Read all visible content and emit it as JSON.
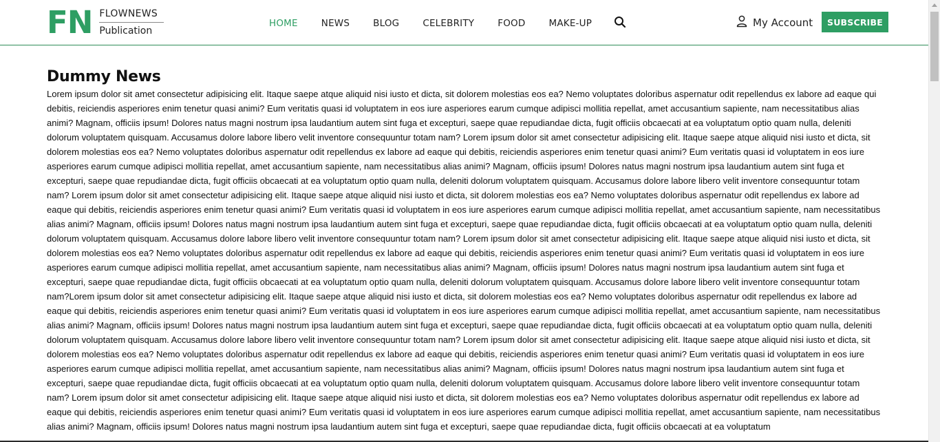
{
  "brand": {
    "mark": "FN",
    "name": "FLOWNEWS",
    "tagline": "Publication"
  },
  "nav": {
    "items": [
      {
        "label": "HOME",
        "active": true
      },
      {
        "label": "NEWS",
        "active": false
      },
      {
        "label": "BLOG",
        "active": false
      },
      {
        "label": "CELEBRITY",
        "active": false
      },
      {
        "label": "FOOD",
        "active": false
      },
      {
        "label": "MAKE-UP",
        "active": false
      }
    ],
    "search_icon": "search-icon"
  },
  "account": {
    "icon": "user-icon",
    "label": "My Account"
  },
  "subscribe": {
    "label": "SUBSCRIBE"
  },
  "article": {
    "title": "Dummy News",
    "body": "Lorem ipsum dolor sit amet consectetur adipisicing elit. Itaque saepe atque aliquid nisi iusto et dicta, sit dolorem molestias eos ea? Nemo voluptates doloribus aspernatur odit repellendus ex labore ad eaque qui debitis, reiciendis asperiores enim tenetur quasi animi? Eum veritatis quasi id voluptatem in eos iure asperiores earum cumque adipisci mollitia repellat, amet accusantium sapiente, nam necessitatibus alias animi? Magnam, officiis ipsum! Dolores natus magni nostrum ipsa laudantium autem sint fuga et excepturi, saepe quae repudiandae dicta, fugit officiis obcaecati at ea voluptatum optio quam nulla, deleniti dolorum voluptatem quisquam. Accusamus dolore labore libero velit inventore consequuntur totam nam? Lorem ipsum dolor sit amet consectetur adipisicing elit. Itaque saepe atque aliquid nisi iusto et dicta, sit dolorem molestias eos ea? Nemo voluptates doloribus aspernatur odit repellendus ex labore ad eaque qui debitis, reiciendis asperiores enim tenetur quasi animi? Eum veritatis quasi id voluptatem in eos iure asperiores earum cumque adipisci mollitia repellat, amet accusantium sapiente, nam necessitatibus alias animi? Magnam, officiis ipsum! Dolores natus magni nostrum ipsa laudantium autem sint fuga et excepturi, saepe quae repudiandae dicta, fugit officiis obcaecati at ea voluptatum optio quam nulla, deleniti dolorum voluptatem quisquam. Accusamus dolore labore libero velit inventore consequuntur totam nam? Lorem ipsum dolor sit amet consectetur adipisicing elit. Itaque saepe atque aliquid nisi iusto et dicta, sit dolorem molestias eos ea? Nemo voluptates doloribus aspernatur odit repellendus ex labore ad eaque qui debitis, reiciendis asperiores enim tenetur quasi animi? Eum veritatis quasi id voluptatem in eos iure asperiores earum cumque adipisci mollitia repellat, amet accusantium sapiente, nam necessitatibus alias animi? Magnam, officiis ipsum! Dolores natus magni nostrum ipsa laudantium autem sint fuga et excepturi, saepe quae repudiandae dicta, fugit officiis obcaecati at ea voluptatum optio quam nulla, deleniti dolorum voluptatem quisquam. Accusamus dolore labore libero velit inventore consequuntur totam nam? Lorem ipsum dolor sit amet consectetur adipisicing elit. Itaque saepe atque aliquid nisi iusto et dicta, sit dolorem molestias eos ea? Nemo voluptates doloribus aspernatur odit repellendus ex labore ad eaque qui debitis, reiciendis asperiores enim tenetur quasi animi? Eum veritatis quasi id voluptatem in eos iure asperiores earum cumque adipisci mollitia repellat, amet accusantium sapiente, nam necessitatibus alias animi? Magnam, officiis ipsum! Dolores natus magni nostrum ipsa laudantium autem sint fuga et excepturi, saepe quae repudiandae dicta, fugit officiis obcaecati at ea voluptatum optio quam nulla, deleniti dolorum voluptatem quisquam. Accusamus dolore labore libero velit inventore consequuntur totam nam?Lorem ipsum dolor sit amet consectetur adipisicing elit. Itaque saepe atque aliquid nisi iusto et dicta, sit dolorem molestias eos ea? Nemo voluptates doloribus aspernatur odit repellendus ex labore ad eaque qui debitis, reiciendis asperiores enim tenetur quasi animi? Eum veritatis quasi id voluptatem in eos iure asperiores earum cumque adipisci mollitia repellat, amet accusantium sapiente, nam necessitatibus alias animi? Magnam, officiis ipsum! Dolores natus magni nostrum ipsa laudantium autem sint fuga et excepturi, saepe quae repudiandae dicta, fugit officiis obcaecati at ea voluptatum optio quam nulla, deleniti dolorum voluptatem quisquam. Accusamus dolore labore libero velit inventore consequuntur totam nam? Lorem ipsum dolor sit amet consectetur adipisicing elit. Itaque saepe atque aliquid nisi iusto et dicta, sit dolorem molestias eos ea? Nemo voluptates doloribus aspernatur odit repellendus ex labore ad eaque qui debitis, reiciendis asperiores enim tenetur quasi animi? Eum veritatis quasi id voluptatem in eos iure asperiores earum cumque adipisci mollitia repellat, amet accusantium sapiente, nam necessitatibus alias animi? Magnam, officiis ipsum! Dolores natus magni nostrum ipsa laudantium autem sint fuga et excepturi, saepe quae repudiandae dicta, fugit officiis obcaecati at ea voluptatum optio quam nulla, deleniti dolorum voluptatem quisquam. Accusamus dolore labore libero velit inventore consequuntur totam nam? Lorem ipsum dolor sit amet consectetur adipisicing elit. Itaque saepe atque aliquid nisi iusto et dicta, sit dolorem molestias eos ea? Nemo voluptates doloribus aspernatur odit repellendus ex labore ad eaque qui debitis, reiciendis asperiores enim tenetur quasi animi? Eum veritatis quasi id voluptatem in eos iure asperiores earum cumque adipisci mollitia repellat, amet accusantium sapiente, nam necessitatibus alias animi? Magnam, officiis ipsum! Dolores natus magni nostrum ipsa laudantium autem sint fuga et excepturi, saepe quae repudiandae dicta, fugit officiis obcaecati at ea voluptatum"
  },
  "colors": {
    "accent": "#2e9e63",
    "text": "#111111",
    "background": "#ffffff"
  }
}
